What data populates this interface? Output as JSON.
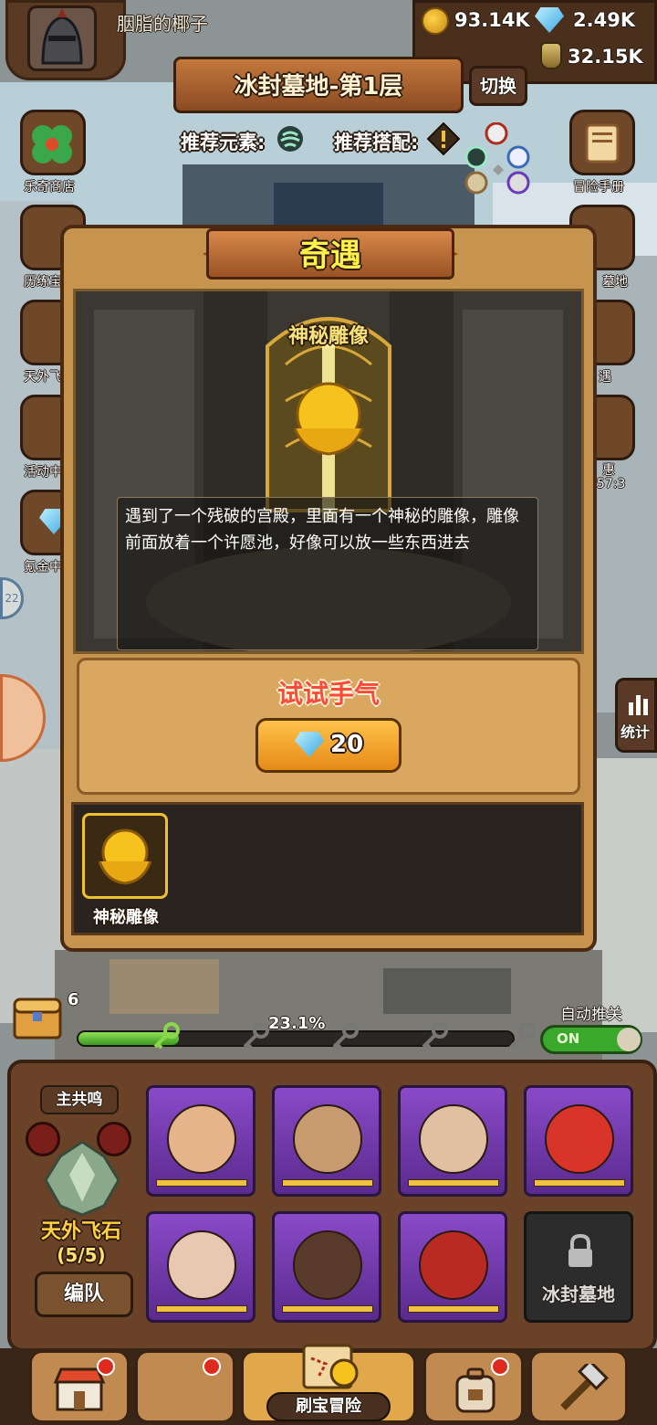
{
  "player": {
    "name": "胭脂的椰子"
  },
  "resources": {
    "gold": "93.14K",
    "diamonds": "2.49K",
    "potion": "32.15K"
  },
  "level": {
    "title": "冰封墓地-第1层",
    "switch_label": "切换"
  },
  "recommend": {
    "element_label": "推荐元素:",
    "combo_label": "推荐搭配:"
  },
  "side_left": [
    "乐奇商店",
    "历练宝",
    "天外飞",
    "活动中",
    "氪金中"
  ],
  "side_right": [
    "冒险手册",
    "墓地",
    "遇",
    "惠",
    "57:3"
  ],
  "badge_left": "22",
  "stats_label": "统计",
  "modal": {
    "title": "奇遇",
    "event_name": "神秘雕像",
    "description": "遇到了一个残破的宫殿，里面有一个神秘的雕像，雕像前面放着一个许愿池，好像可以放一些东西进去",
    "try_title": "试试手气",
    "try_cost": "20",
    "reward_label": "神秘雕像"
  },
  "progress": {
    "percent": 23.1,
    "percent_label": "23.1%",
    "chest_count": "6"
  },
  "auto": {
    "label": "自动推关",
    "state": "ON"
  },
  "team": {
    "resonance_label": "主共鸣",
    "name": "天外飞石",
    "count": "(5/5)",
    "formation_label": "编队",
    "locked_label": "冰封墓地"
  },
  "nav": {
    "active_label": "刷宝冒险"
  },
  "colors": {
    "accent": "#e58a18",
    "title_yellow": "#fff04a",
    "try_red": "#ff4a3a",
    "hero_purple": "#8a4ac8"
  }
}
